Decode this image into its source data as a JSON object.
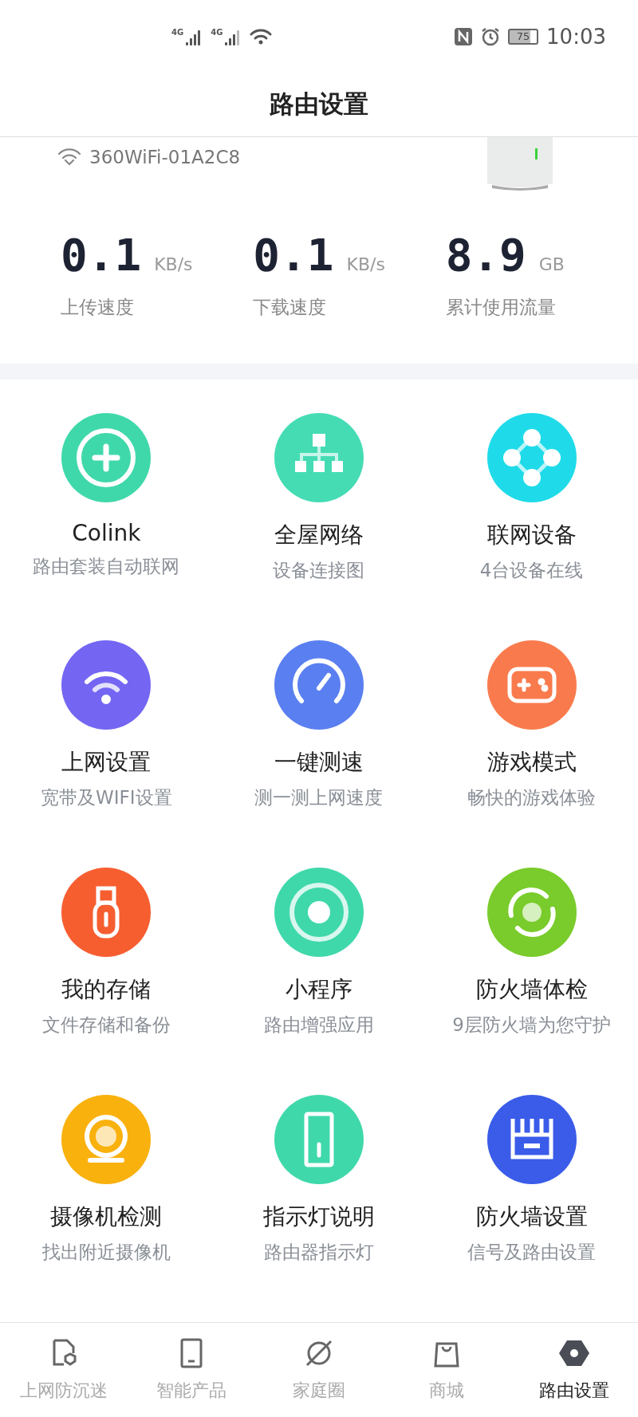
{
  "status_bar": {
    "sim_labels": [
      "4G",
      "4G"
    ],
    "battery": "75",
    "time": "10:03"
  },
  "header": {
    "title": "路由设置"
  },
  "router": {
    "wifi_name": "360WiFi-01A2C8"
  },
  "stats": [
    {
      "value": "0.1",
      "unit": "KB/s",
      "label": "上传速度"
    },
    {
      "value": "0.1",
      "unit": "KB/s",
      "label": "下载速度"
    },
    {
      "value": "8.9",
      "unit": "GB",
      "label": "累计使用流量"
    }
  ],
  "features": [
    {
      "title": "Colink",
      "subtitle": "路由套装自动联网",
      "color": "#3fd8ab"
    },
    {
      "title": "全屋网络",
      "subtitle": "设备连接图",
      "color": "#45dcb4"
    },
    {
      "title": "联网设备",
      "subtitle": "4台设备在线",
      "color": "#1fdbe9"
    },
    {
      "title": "上网设置",
      "subtitle": "宽带及WIFI设置",
      "color": "#7466f2"
    },
    {
      "title": "一键测速",
      "subtitle": "测一测上网速度",
      "color": "#5a7ff0"
    },
    {
      "title": "游戏模式",
      "subtitle": "畅快的游戏体验",
      "color": "#f97b4d"
    },
    {
      "title": "我的存储",
      "subtitle": "文件存储和备份",
      "color": "#f65e30"
    },
    {
      "title": "小程序",
      "subtitle": "路由增强应用",
      "color": "#3fd8ab"
    },
    {
      "title": "防火墙体检",
      "subtitle": "9层防火墙为您守护",
      "color": "#79cc2b"
    },
    {
      "title": "摄像机检测",
      "subtitle": "找出附近摄像机",
      "color": "#f9b10e"
    },
    {
      "title": "指示灯说明",
      "subtitle": "路由器指示灯",
      "color": "#3fd8ab"
    },
    {
      "title": "防火墙设置",
      "subtitle": "信号及路由设置",
      "color": "#3a5ce9"
    }
  ],
  "bottom_nav": [
    {
      "label": "上网防沉迷",
      "selected": false
    },
    {
      "label": "智能产品",
      "selected": false
    },
    {
      "label": "家庭圈",
      "selected": false
    },
    {
      "label": "商城",
      "selected": false
    },
    {
      "label": "路由设置",
      "selected": true
    }
  ]
}
